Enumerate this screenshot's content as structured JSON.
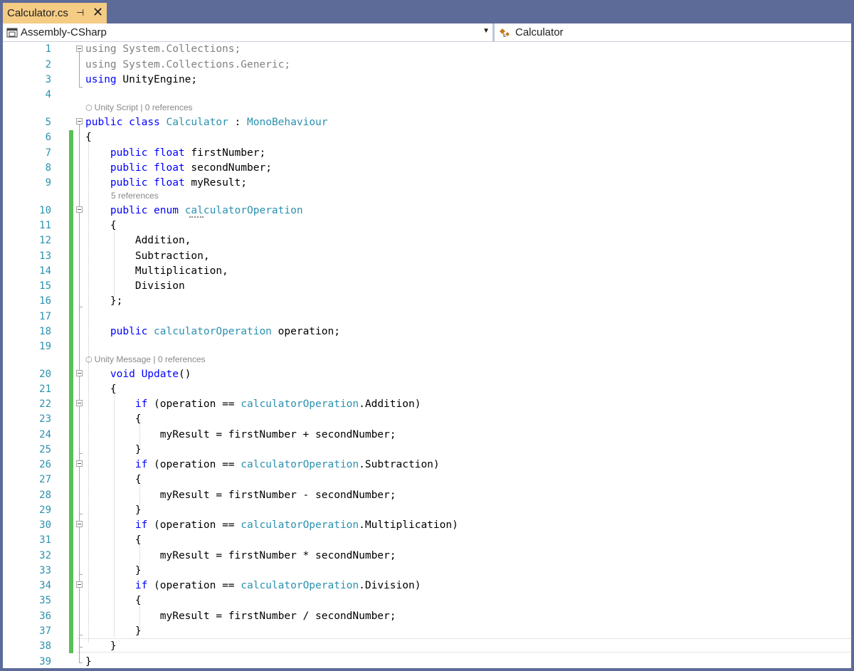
{
  "tab": {
    "title": "Calculator.cs",
    "pin_glyph": "⊣",
    "close_glyph": "✕"
  },
  "nav": {
    "project": "Assembly-CSharp",
    "class": "Calculator"
  },
  "colors": {
    "keyword": "#0000ff",
    "type": "#2b91af",
    "line_number": "#2b91af",
    "change_bar": "#57c057",
    "tab_active": "#f5cc84",
    "chrome": "#5d6b99"
  },
  "lens": {
    "unity_script": "Unity Script | 0 references",
    "five_refs": "5 references",
    "unity_message": "Unity Message | 0 references"
  },
  "lines": [
    {
      "n": "1",
      "html": "<span class=\"gray\"><span class=\"kw\" style=\"color:#808080\">using</span> System.Collections;</span>"
    },
    {
      "n": "2",
      "html": "<span class=\"gray\">using System.Collections.Generic;</span>"
    },
    {
      "n": "3",
      "html": "<span class=\"kw\">using</span> UnityEngine;"
    },
    {
      "n": "4",
      "html": ""
    },
    {
      "n": "5",
      "html": "<span class=\"kw\">public</span> <span class=\"kw\">class</span> <span class=\"ty\">Calculator</span> : <span class=\"ty\">MonoBehaviour</span>"
    },
    {
      "n": "6",
      "html": "{"
    },
    {
      "n": "7",
      "html": "    <span class=\"kw\">public</span> <span class=\"kw\">float</span> firstNumber;"
    },
    {
      "n": "8",
      "html": "    <span class=\"kw\">public</span> <span class=\"kw\">float</span> secondNumber;"
    },
    {
      "n": "9",
      "html": "    <span class=\"kw\">public</span> <span class=\"kw\">float</span> myResult;"
    },
    {
      "n": "10",
      "html": "    <span class=\"kw\">public</span> <span class=\"kw\">enum</span> <span class=\"ty\">calculatorOperation</span>"
    },
    {
      "n": "11",
      "html": "    {"
    },
    {
      "n": "12",
      "html": "        Addition,"
    },
    {
      "n": "13",
      "html": "        Subtraction,"
    },
    {
      "n": "14",
      "html": "        Multiplication,"
    },
    {
      "n": "15",
      "html": "        Division"
    },
    {
      "n": "16",
      "html": "    };"
    },
    {
      "n": "17",
      "html": ""
    },
    {
      "n": "18",
      "html": "    <span class=\"kw\">public</span> <span class=\"ty\">calculatorOperation</span> operation;"
    },
    {
      "n": "19",
      "html": ""
    },
    {
      "n": "20",
      "html": "    <span class=\"kw\">void</span> <span class=\"kw\" style=\"color:#0000ff\">Update</span>()"
    },
    {
      "n": "21",
      "html": "    {"
    },
    {
      "n": "22",
      "html": "        <span class=\"kw\">if</span> (operation == <span class=\"ty\">calculatorOperation</span>.Addition)"
    },
    {
      "n": "23",
      "html": "        {"
    },
    {
      "n": "24",
      "html": "            myResult = firstNumber + secondNumber;"
    },
    {
      "n": "25",
      "html": "        }"
    },
    {
      "n": "26",
      "html": "        <span class=\"kw\">if</span> (operation == <span class=\"ty\">calculatorOperation</span>.Subtraction)"
    },
    {
      "n": "27",
      "html": "        {"
    },
    {
      "n": "28",
      "html": "            myResult = firstNumber - secondNumber;"
    },
    {
      "n": "29",
      "html": "        }"
    },
    {
      "n": "30",
      "html": "        <span class=\"kw\">if</span> (operation == <span class=\"ty\">calculatorOperation</span>.Multiplication)"
    },
    {
      "n": "31",
      "html": "        {"
    },
    {
      "n": "32",
      "html": "            myResult = firstNumber * secondNumber;"
    },
    {
      "n": "33",
      "html": "        }"
    },
    {
      "n": "34",
      "html": "        <span class=\"kw\">if</span> (operation == <span class=\"ty\">calculatorOperation</span>.Division)"
    },
    {
      "n": "35",
      "html": "        {"
    },
    {
      "n": "36",
      "html": "            myResult = firstNumber / secondNumber;"
    },
    {
      "n": "37",
      "html": "        }"
    },
    {
      "n": "38",
      "html": "    }"
    },
    {
      "n": "39",
      "html": "}"
    }
  ]
}
